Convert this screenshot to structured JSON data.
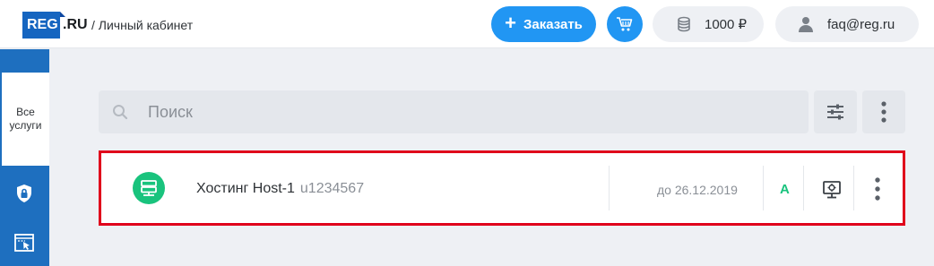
{
  "header": {
    "logo_box": "REG",
    "logo_rest": ".RU",
    "breadcrumb": "/ Личный кабинет",
    "order_button": "Заказать",
    "balance": "1000 ₽",
    "user_email": "faq@reg.ru"
  },
  "sidebar": {
    "all_services_label": "Все услуги"
  },
  "search": {
    "placeholder": "Поиск"
  },
  "service": {
    "name": "Хостинг Host-1",
    "login": "u1234567",
    "expiry": "до 26.12.2019",
    "status": "A"
  },
  "colors": {
    "accent": "#2196f3",
    "sidebar": "#1e6fbf",
    "success": "#19c37d",
    "highlight": "#e0001b"
  }
}
